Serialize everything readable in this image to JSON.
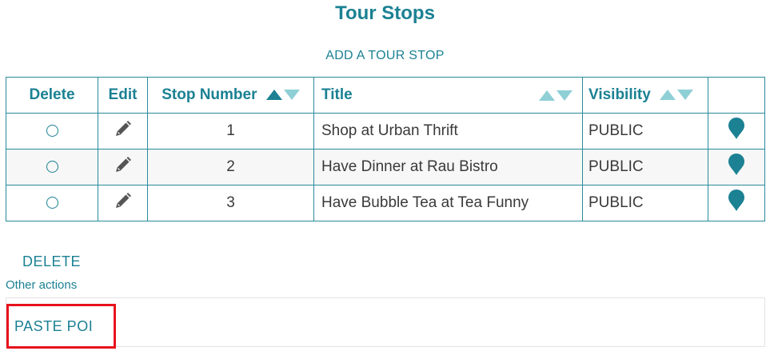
{
  "page": {
    "title": "Tour Stops",
    "add_link": "ADD A TOUR STOP"
  },
  "table": {
    "headers": {
      "delete": "Delete",
      "edit": "Edit",
      "stop_number": "Stop Number",
      "title": "Title",
      "visibility": "Visibility"
    },
    "rows": [
      {
        "stop_number": "1",
        "title": "Shop at Urban Thrift",
        "visibility": "PUBLIC"
      },
      {
        "stop_number": "2",
        "title": "Have Dinner at Rau Bistro",
        "visibility": "PUBLIC"
      },
      {
        "stop_number": "3",
        "title": "Have Bubble Tea at Tea Funny",
        "visibility": "PUBLIC"
      }
    ],
    "icons": {
      "edit": "pencil-icon",
      "location": "map-pin-icon",
      "sort": "sort-arrows-icon"
    }
  },
  "actions": {
    "delete_label": "DELETE",
    "other_actions_label": "Other actions",
    "paste_poi_label": "PASTE POI"
  },
  "colors": {
    "accent": "#1b8193",
    "sort_inactive": "#8fcfd6",
    "highlight_border": "#e8121c"
  }
}
